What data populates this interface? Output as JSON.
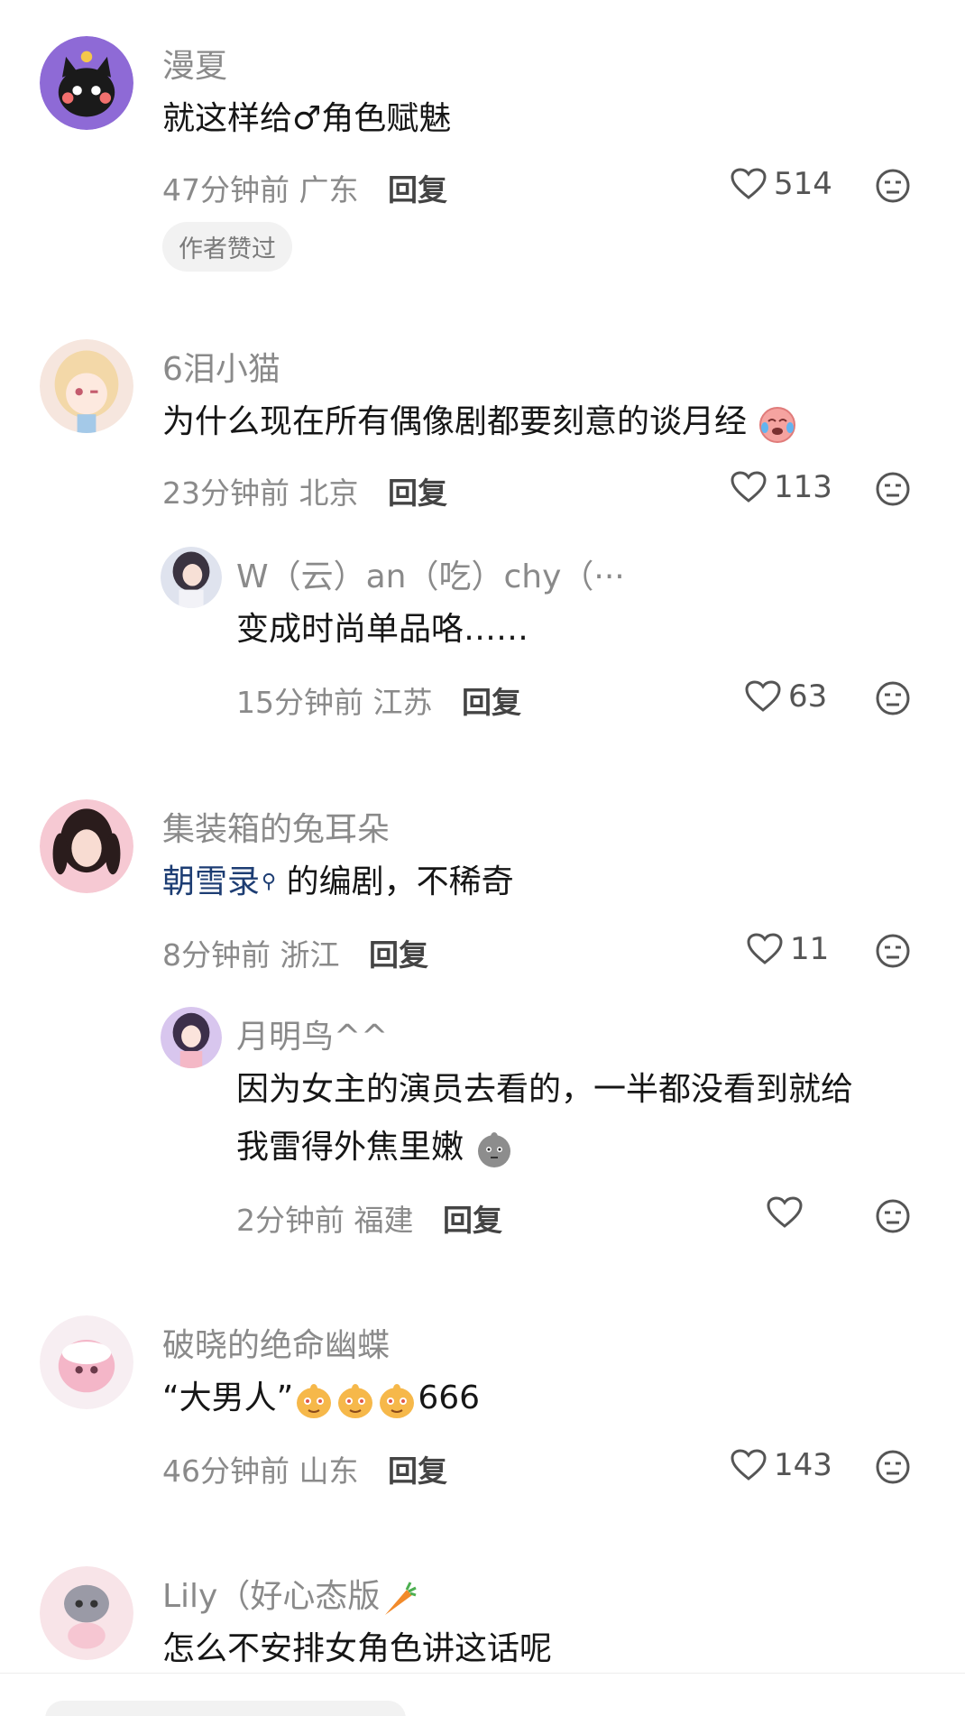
{
  "comments": [
    {
      "user": "漫夏",
      "text": "就这样给♂角色赋魅",
      "time": "47分钟前",
      "location": "广东",
      "reply_label": "回复",
      "likes": "514",
      "badge": "作者赞过"
    },
    {
      "user": "6泪小猫",
      "text": "为什么现在所有偶像剧都要刻意的谈月经",
      "time": "23分钟前",
      "location": "北京",
      "reply_label": "回复",
      "likes": "113",
      "replies": [
        {
          "user": "W（云）an（吃）chy（···",
          "text": "变成时尚单品咯……",
          "time": "15分钟前",
          "location": "江苏",
          "reply_label": "回复",
          "likes": "63"
        }
      ]
    },
    {
      "user": "集装箱的兔耳朵",
      "text_link": "朝雪录",
      "text": " 的编剧，不稀奇",
      "time": "8分钟前",
      "location": "浙江",
      "reply_label": "回复",
      "likes": "11",
      "replies": [
        {
          "user": "月明鸟^^",
          "text_line1": "因为女主的演员去看的，一半都没看到就给",
          "text_line2": "我雷得外焦里嫩",
          "time": "2分钟前",
          "location": "福建",
          "reply_label": "回复",
          "likes": ""
        }
      ]
    },
    {
      "user": "破晓的绝命幽蝶",
      "text": "“大男人”",
      "text_suffix": "666",
      "time": "46分钟前",
      "location": "山东",
      "reply_label": "回复",
      "likes": "143"
    },
    {
      "user": "Lily（好心态版",
      "text": "怎么不安排女角色讲这话呢"
    }
  ],
  "colors": {
    "meta_gray": "#8a8a8a",
    "link_blue": "#1d3d73"
  }
}
